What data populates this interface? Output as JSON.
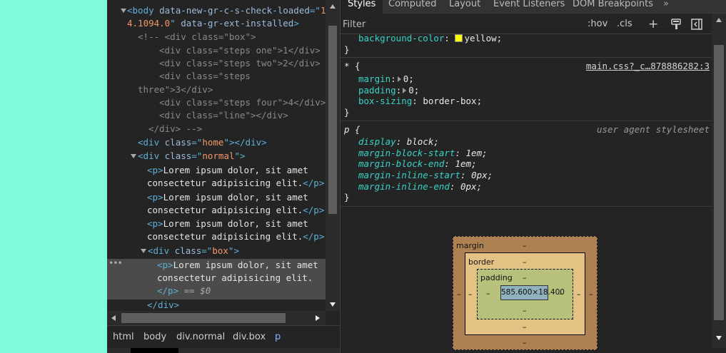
{
  "dom": {
    "lines": [
      {
        "parts": [
          [
            "tag",
            "<body "
          ],
          [
            "an",
            "data-new-gr-c-s-check-loaded"
          ],
          [
            "tag",
            "=\""
          ],
          [
            "av",
            "1"
          ]
        ]
      },
      {
        "parts": [
          [
            "av",
            "4.1094.0"
          ],
          [
            "tag",
            "\" "
          ],
          [
            "an",
            "data-gr-ext-installed"
          ],
          [
            "tag",
            ">"
          ]
        ]
      },
      {
        "parts": [
          [
            "cm",
            "<!-- <div class=\"box\">"
          ]
        ]
      },
      {
        "parts": [
          [
            "cm",
            "<div class=\"steps one\">1</div>"
          ]
        ]
      },
      {
        "parts": [
          [
            "cm",
            "<div class=\"steps two\">2</div>"
          ]
        ]
      },
      {
        "parts": [
          [
            "cm",
            "<div class=\"steps"
          ]
        ]
      },
      {
        "parts": [
          [
            "cm",
            "three\">3</div>"
          ]
        ]
      },
      {
        "parts": [
          [
            "cm",
            "<div class=\"steps four\">4</div>"
          ]
        ]
      },
      {
        "parts": [
          [
            "cm",
            "<div class=\"line\"></div>"
          ]
        ]
      },
      {
        "parts": [
          [
            "cm",
            "</div> -->"
          ]
        ]
      },
      {
        "parts": [
          [
            "tag",
            "<div "
          ],
          [
            "an",
            "class"
          ],
          [
            "tag",
            "=\""
          ],
          [
            "av",
            "home"
          ],
          [
            "tag",
            "\"></div>"
          ]
        ]
      },
      {
        "parts": [
          [
            "tag",
            "<div "
          ],
          [
            "an",
            "class"
          ],
          [
            "tag",
            "=\""
          ],
          [
            "av",
            "normal"
          ],
          [
            "tag",
            "\">"
          ]
        ]
      },
      {
        "parts": [
          [
            "tag",
            "<p>"
          ],
          [
            "tx",
            "Lorem ipsum dolor, sit amet"
          ]
        ]
      },
      {
        "parts": [
          [
            "tx",
            "consectetur adipisicing elit."
          ],
          [
            "tag",
            "</p>"
          ]
        ]
      },
      {
        "parts": [
          [
            "tag",
            "<p>"
          ],
          [
            "tx",
            "Lorem ipsum dolor, sit amet"
          ]
        ]
      },
      {
        "parts": [
          [
            "tx",
            "consectetur adipisicing elit."
          ],
          [
            "tag",
            "</p>"
          ]
        ]
      },
      {
        "parts": [
          [
            "tag",
            "<p>"
          ],
          [
            "tx",
            "Lorem ipsum dolor, sit amet"
          ]
        ]
      },
      {
        "parts": [
          [
            "tx",
            "consectetur adipisicing elit."
          ],
          [
            "tag",
            "</p>"
          ]
        ]
      },
      {
        "parts": [
          [
            "tag",
            "<div "
          ],
          [
            "an",
            "class"
          ],
          [
            "tag",
            "=\""
          ],
          [
            "av",
            "box"
          ],
          [
            "tag",
            "\">"
          ]
        ]
      },
      {
        "parts": [
          [
            "tag",
            "<p>"
          ],
          [
            "tx",
            "Lorem ipsum dolor, sit amet"
          ]
        ]
      },
      {
        "parts": [
          [
            "tx",
            "consectetur adipisicing elit."
          ]
        ]
      },
      {
        "parts": [
          [
            "tag",
            "</p>"
          ],
          [
            "eq",
            " == $0"
          ]
        ]
      },
      {
        "parts": [
          [
            "tag",
            "</div>"
          ]
        ]
      }
    ],
    "selected_marker": "•••"
  },
  "breadcrumbs": [
    "html",
    "body",
    "div.normal",
    "div.box",
    "p"
  ],
  "tabs": [
    "Styles",
    "Computed",
    "Layout",
    "Event Listeners",
    "DOM Breakpoints",
    "»"
  ],
  "filter": {
    "placeholder": "Filter",
    "value": ""
  },
  "filter_buttons": {
    "hov": ":hov",
    "cls": ".cls",
    "add": "+"
  },
  "rules": {
    "yellow_rule": {
      "property": "background-color",
      "value": "yellow",
      "close": "}"
    },
    "star_rule": {
      "selector": "* {",
      "source": "main.css?_c…878886282:3",
      "decls": [
        [
          "margin",
          "0"
        ],
        [
          "padding",
          "0"
        ],
        [
          "box-sizing",
          "border-box"
        ]
      ],
      "close": "}"
    },
    "p_rule": {
      "selector": "p {",
      "source": "user agent stylesheet",
      "decls": [
        [
          "display",
          "block"
        ],
        [
          "margin-block-start",
          "1em"
        ],
        [
          "margin-block-end",
          "1em"
        ],
        [
          "margin-inline-start",
          "0px"
        ],
        [
          "margin-inline-end",
          "0px"
        ]
      ],
      "close": "}"
    }
  },
  "box_model": {
    "margin_label": "margin",
    "border_label": "border",
    "padding_label": "padding",
    "content": "585.600×18.400",
    "dash": "–"
  },
  "colors": {
    "swatch": "#ffff00",
    "accent": "#7cb7ff",
    "viewport": "#7ffcd9"
  }
}
